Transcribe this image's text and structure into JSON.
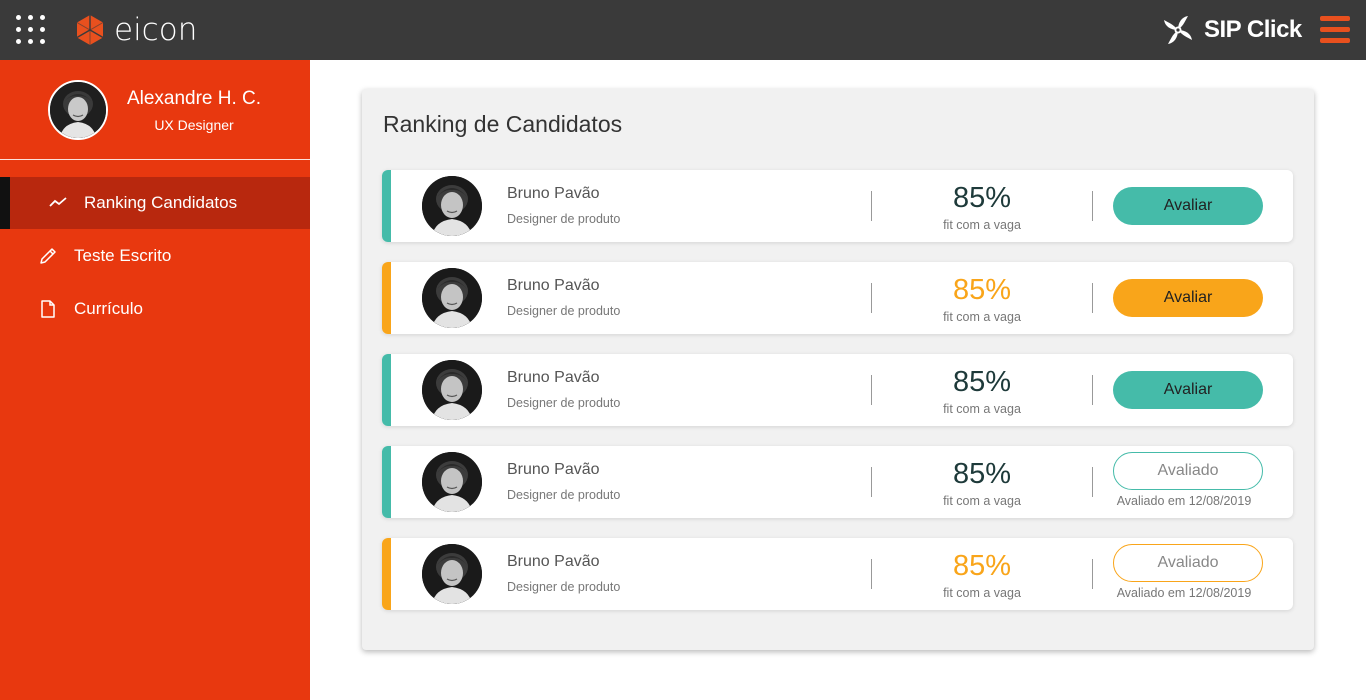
{
  "header": {
    "logo_text": "eicon",
    "brand_text": "SIP Click",
    "colors": {
      "bar": "#3a3a3a",
      "logo": "#e8501e",
      "menu": "#e8501e"
    }
  },
  "sidebar": {
    "user": {
      "name": "Alexandre H. C.",
      "role": "UX Designer"
    },
    "items": [
      {
        "label": "Ranking Candidatos",
        "icon": "trend-icon",
        "active": true
      },
      {
        "label": "Teste Escrito",
        "icon": "pencil-icon",
        "active": false
      },
      {
        "label": "Currículo",
        "icon": "document-icon",
        "active": false
      }
    ],
    "colors": {
      "bg": "#e8380f",
      "active_bg": "#b8280e"
    }
  },
  "main": {
    "title": "Ranking de Candidatos",
    "candidates": [
      {
        "name": "Bruno Pavão",
        "role": "Designer de produto",
        "fit": "85%",
        "fit_label": "fit com a vaga",
        "action": "Avaliar",
        "accent": "#45bba9",
        "status": "pending",
        "eval_date": ""
      },
      {
        "name": "Bruno Pavão",
        "role": "Designer de produto",
        "fit": "85%",
        "fit_label": "fit com a vaga",
        "action": "Avaliar",
        "accent": "#f9a51a",
        "status": "pending",
        "eval_date": ""
      },
      {
        "name": "Bruno Pavão",
        "role": "Designer de produto",
        "fit": "85%",
        "fit_label": "fit com a vaga",
        "action": "Avaliar",
        "accent": "#45bba9",
        "status": "pending",
        "eval_date": ""
      },
      {
        "name": "Bruno Pavão",
        "role": "Designer de produto",
        "fit": "85%",
        "fit_label": "fit com a vaga",
        "action": "Avaliado",
        "accent": "#45bba9",
        "status": "evaluated",
        "eval_date": "Avaliado em 12/08/2019"
      },
      {
        "name": "Bruno Pavão",
        "role": "Designer de produto",
        "fit": "85%",
        "fit_label": "fit com a vaga",
        "action": "Avaliado",
        "accent": "#f9a51a",
        "status": "evaluated",
        "eval_date": "Avaliado em 12/08/2019"
      }
    ]
  }
}
